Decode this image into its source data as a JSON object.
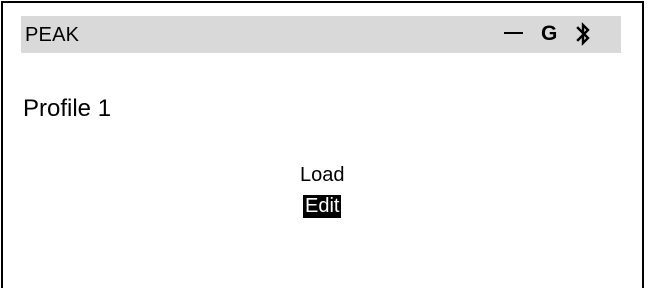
{
  "status_bar": {
    "title": "PEAK",
    "icons": [
      "dash-icon",
      "g-icon",
      "bluetooth-icon"
    ],
    "g_label": "G",
    "background_color": "#d9d9d9"
  },
  "profile": {
    "title": "Profile 1"
  },
  "menu": {
    "items": [
      {
        "label": "Load",
        "selected": false
      },
      {
        "label": "Edit",
        "selected": true
      }
    ],
    "selected_color": "#000000",
    "selected_text_color": "#ffffff"
  }
}
